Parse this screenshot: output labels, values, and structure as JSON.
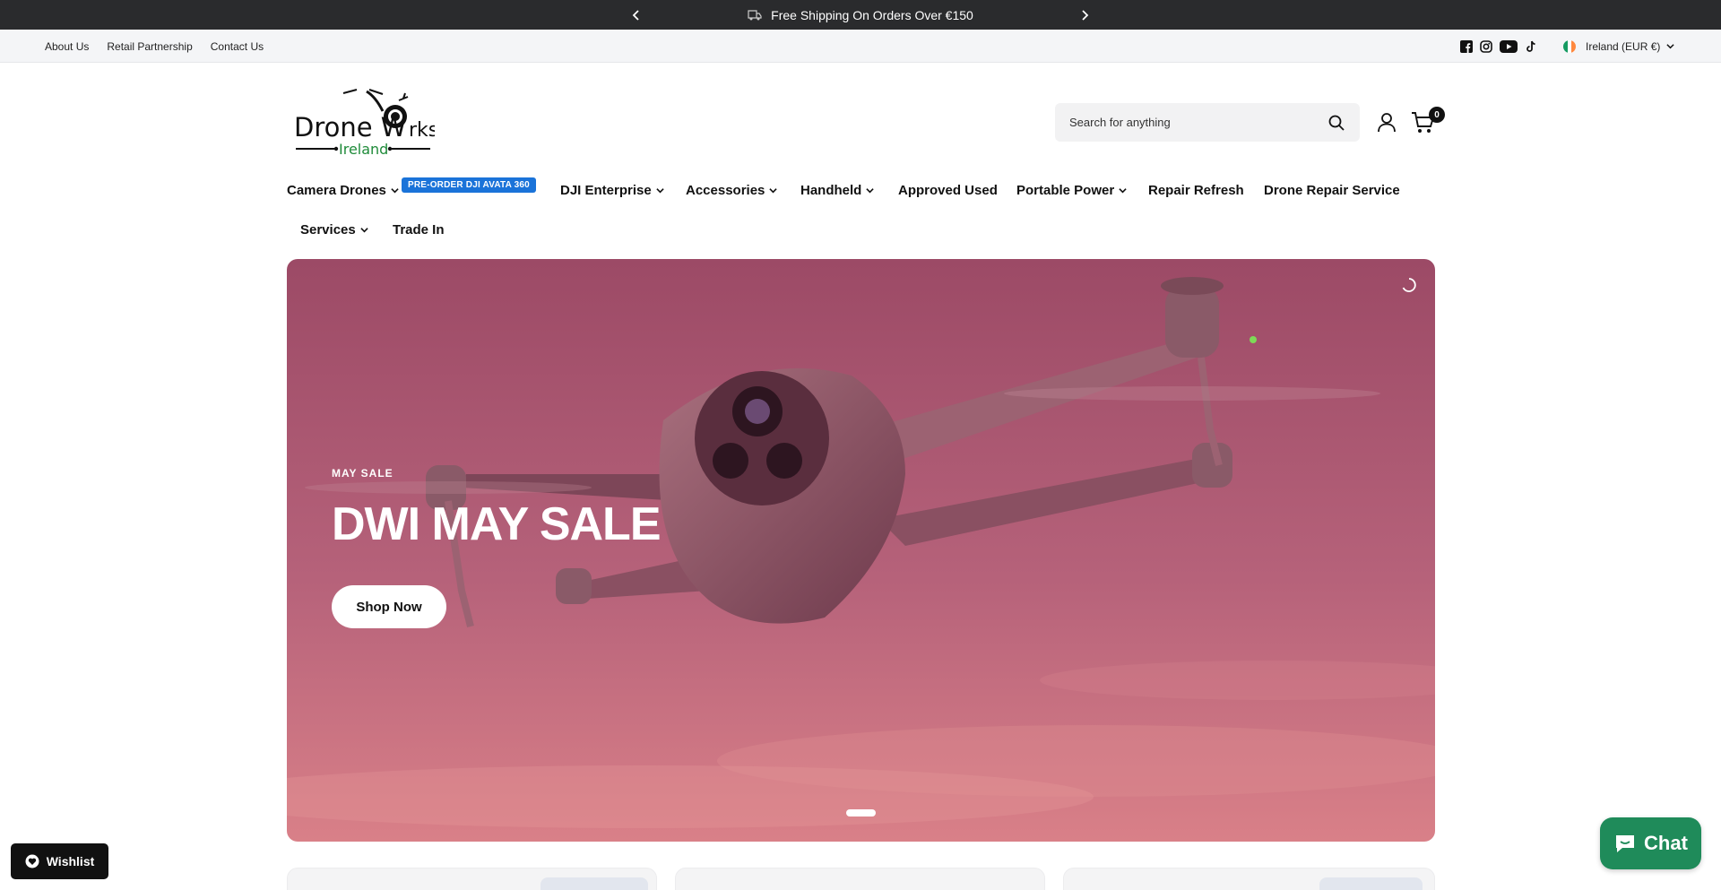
{
  "announcement": {
    "message": "Free Shipping On Orders Over €150"
  },
  "utility": {
    "links": [
      "About Us",
      "Retail Partnership",
      "Contact Us"
    ],
    "locale": "Ireland (EUR €)"
  },
  "header": {
    "logo_line1": "Drone W",
    "logo_line1b": "rks",
    "logo_line2": "Ireland",
    "search_placeholder": "Search for anything",
    "cart_count": "0"
  },
  "nav": {
    "camera_drones": "Camera Drones",
    "badge": "PRE-ORDER DJI AVATA 360",
    "dji_enterprise": "DJI Enterprise",
    "accessories": "Accessories",
    "handheld": "Handheld",
    "approved_used": "Approved Used",
    "portable_power": "Portable Power",
    "repair_refresh": "Repair Refresh",
    "drone_repair_service": "Drone Repair Service",
    "services": "Services",
    "trade_in": "Trade In"
  },
  "hero": {
    "eyebrow": "MAY SALE",
    "title": "DWI MAY SALE",
    "cta": "Shop Now"
  },
  "floating": {
    "wishlist": "Wishlist",
    "chat": "Chat"
  },
  "colors": {
    "announce_bg": "#2a2b2d",
    "badge_blue": "#1a73d9",
    "chat_green": "#1f8b5a",
    "hero_tint": "#b0566e"
  }
}
